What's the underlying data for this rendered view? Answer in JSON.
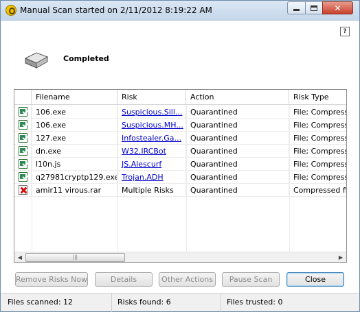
{
  "window": {
    "title": "Manual Scan started on 2/11/2012 8:19:22 AM"
  },
  "header": {
    "status": "Completed",
    "icon": "drive-icon"
  },
  "table": {
    "columns": [
      "Filename",
      "Risk",
      "Action",
      "Risk Type"
    ],
    "rows": [
      {
        "icon": "file-quarantined-icon",
        "filename": "106.exe",
        "risk": "Suspicious.Sill...",
        "risk_is_link": true,
        "action": "Quarantined",
        "risk_type": "File; Compress"
      },
      {
        "icon": "file-quarantined-icon",
        "filename": "106.exe",
        "risk": "Suspicious.MH...",
        "risk_is_link": true,
        "action": "Quarantined",
        "risk_type": "File; Compress"
      },
      {
        "icon": "file-quarantined-icon",
        "filename": "127.exe",
        "risk": "Infostealer.Ga...",
        "risk_is_link": true,
        "action": "Quarantined",
        "risk_type": "File; Compress"
      },
      {
        "icon": "file-quarantined-icon",
        "filename": "dn.exe",
        "risk": "W32.IRCBot",
        "risk_is_link": true,
        "action": "Quarantined",
        "risk_type": "File; Compress"
      },
      {
        "icon": "file-quarantined-icon",
        "filename": "l10n.js",
        "risk": "JS.Alescurf",
        "risk_is_link": true,
        "action": "Quarantined",
        "risk_type": "File; Compress"
      },
      {
        "icon": "file-quarantined-icon",
        "filename": "q27981cryptp129.exe",
        "risk": "Trojan.ADH",
        "risk_is_link": true,
        "action": "Quarantined",
        "risk_type": "File; Compress"
      },
      {
        "icon": "file-risk-icon",
        "filename": "amir11 virous.rar",
        "risk": "Multiple Risks",
        "risk_is_link": false,
        "action": "Quarantined",
        "risk_type": "Compressed fi"
      }
    ]
  },
  "buttons": {
    "remove_risks": "Remove Risks Now",
    "details": "Details",
    "other_actions": "Other Actions",
    "pause_scan": "Pause Scan",
    "close": "Close"
  },
  "statusbar": {
    "files_scanned": "Files scanned: 12",
    "risks_found": "Risks found: 6",
    "files_trusted": "Files trusted: 0"
  },
  "colors": {
    "link": "#0000cc",
    "disabled_text": "#8b8b8b",
    "titlebar": "#c4d6ea"
  }
}
